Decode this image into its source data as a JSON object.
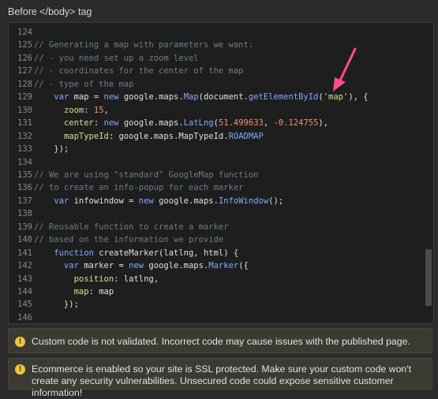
{
  "section_title": "Before </body> tag",
  "editor": {
    "lines": [
      {
        "num": "124",
        "tokens": []
      },
      {
        "num": "125",
        "tokens": [
          {
            "t": "// Generating a map with parameters we want:",
            "c": "comment"
          }
        ]
      },
      {
        "num": "126",
        "tokens": [
          {
            "t": "// - you need set up a zoom level",
            "c": "comment"
          }
        ]
      },
      {
        "num": "127",
        "tokens": [
          {
            "t": "// - coordinates for the center of the map",
            "c": "comment"
          }
        ]
      },
      {
        "num": "128",
        "tokens": [
          {
            "t": "// - type of the map",
            "c": "comment"
          }
        ]
      },
      {
        "num": "129",
        "tokens": [
          {
            "t": "    ",
            "c": "plain"
          },
          {
            "t": "var",
            "c": "kw"
          },
          {
            "t": " map = ",
            "c": "plain"
          },
          {
            "t": "new",
            "c": "kw"
          },
          {
            "t": " google.maps.",
            "c": "plain"
          },
          {
            "t": "Map",
            "c": "fn"
          },
          {
            "t": "(document.",
            "c": "plain"
          },
          {
            "t": "getElementById",
            "c": "fn"
          },
          {
            "t": "(",
            "c": "plain"
          },
          {
            "t": "'map'",
            "c": "str"
          },
          {
            "t": "), {",
            "c": "plain"
          }
        ]
      },
      {
        "num": "130",
        "tokens": [
          {
            "t": "      ",
            "c": "plain"
          },
          {
            "t": "zoom",
            "c": "prop"
          },
          {
            "t": ": ",
            "c": "plain"
          },
          {
            "t": "15",
            "c": "num"
          },
          {
            "t": ",",
            "c": "plain"
          }
        ]
      },
      {
        "num": "131",
        "tokens": [
          {
            "t": "      ",
            "c": "plain"
          },
          {
            "t": "center",
            "c": "prop"
          },
          {
            "t": ": ",
            "c": "plain"
          },
          {
            "t": "new",
            "c": "kw"
          },
          {
            "t": " google.maps.",
            "c": "plain"
          },
          {
            "t": "LatLng",
            "c": "fn"
          },
          {
            "t": "(",
            "c": "plain"
          },
          {
            "t": "51.499633",
            "c": "num"
          },
          {
            "t": ", ",
            "c": "plain"
          },
          {
            "t": "-0.124755",
            "c": "num"
          },
          {
            "t": "),",
            "c": "plain"
          }
        ]
      },
      {
        "num": "132",
        "tokens": [
          {
            "t": "      ",
            "c": "plain"
          },
          {
            "t": "mapTypeId",
            "c": "prop"
          },
          {
            "t": ": google.maps.MapTypeId.",
            "c": "plain"
          },
          {
            "t": "ROADMAP",
            "c": "kw"
          }
        ]
      },
      {
        "num": "133",
        "tokens": [
          {
            "t": "    });",
            "c": "plain"
          }
        ]
      },
      {
        "num": "134",
        "tokens": []
      },
      {
        "num": "135",
        "tokens": [
          {
            "t": "// We are using \"standard\" GoogleMap function",
            "c": "comment"
          }
        ]
      },
      {
        "num": "136",
        "tokens": [
          {
            "t": "// to create an info-popup for each marker",
            "c": "comment"
          }
        ]
      },
      {
        "num": "137",
        "tokens": [
          {
            "t": "    ",
            "c": "plain"
          },
          {
            "t": "var",
            "c": "kw"
          },
          {
            "t": " infowindow = ",
            "c": "plain"
          },
          {
            "t": "new",
            "c": "kw"
          },
          {
            "t": " google.maps.",
            "c": "plain"
          },
          {
            "t": "InfoWindow",
            "c": "fn"
          },
          {
            "t": "();",
            "c": "plain"
          }
        ]
      },
      {
        "num": "138",
        "tokens": []
      },
      {
        "num": "139",
        "tokens": [
          {
            "t": "// Reusable function to create a marker",
            "c": "comment"
          }
        ]
      },
      {
        "num": "140",
        "tokens": [
          {
            "t": "// based on the information we provide",
            "c": "comment"
          }
        ]
      },
      {
        "num": "141",
        "tokens": [
          {
            "t": "    ",
            "c": "plain"
          },
          {
            "t": "function",
            "c": "kw"
          },
          {
            "t": " createMarker(latlng, html) {",
            "c": "plain"
          }
        ]
      },
      {
        "num": "142",
        "tokens": [
          {
            "t": "      ",
            "c": "plain"
          },
          {
            "t": "var",
            "c": "kw"
          },
          {
            "t": " marker = ",
            "c": "plain"
          },
          {
            "t": "new",
            "c": "kw"
          },
          {
            "t": " google.maps.",
            "c": "plain"
          },
          {
            "t": "Marker",
            "c": "fn"
          },
          {
            "t": "({",
            "c": "plain"
          }
        ]
      },
      {
        "num": "143",
        "tokens": [
          {
            "t": "        ",
            "c": "plain"
          },
          {
            "t": "position",
            "c": "prop"
          },
          {
            "t": ": latlng,",
            "c": "plain"
          }
        ]
      },
      {
        "num": "144",
        "tokens": [
          {
            "t": "        ",
            "c": "plain"
          },
          {
            "t": "map",
            "c": "prop"
          },
          {
            "t": ": map",
            "c": "plain"
          }
        ]
      },
      {
        "num": "145",
        "tokens": [
          {
            "t": "      });",
            "c": "plain"
          }
        ]
      },
      {
        "num": "146",
        "tokens": []
      }
    ]
  },
  "annotation": {
    "icon": "arrow-annotation",
    "color": "#ff4d8d"
  },
  "notices": [
    {
      "icon": "warning-icon",
      "text": "Custom code is not validated. Incorrect code may cause issues with the published page."
    },
    {
      "icon": "warning-icon",
      "text": "Ecommerce is enabled so your site is SSL protected. Make sure your custom code won't create any security vulnerabilities. Unsecured code could expose sensitive customer information!"
    }
  ],
  "colors": {
    "warning": "#f0c43a",
    "background": "#2b2b2b",
    "editor_bg": "#1e1e1e"
  }
}
